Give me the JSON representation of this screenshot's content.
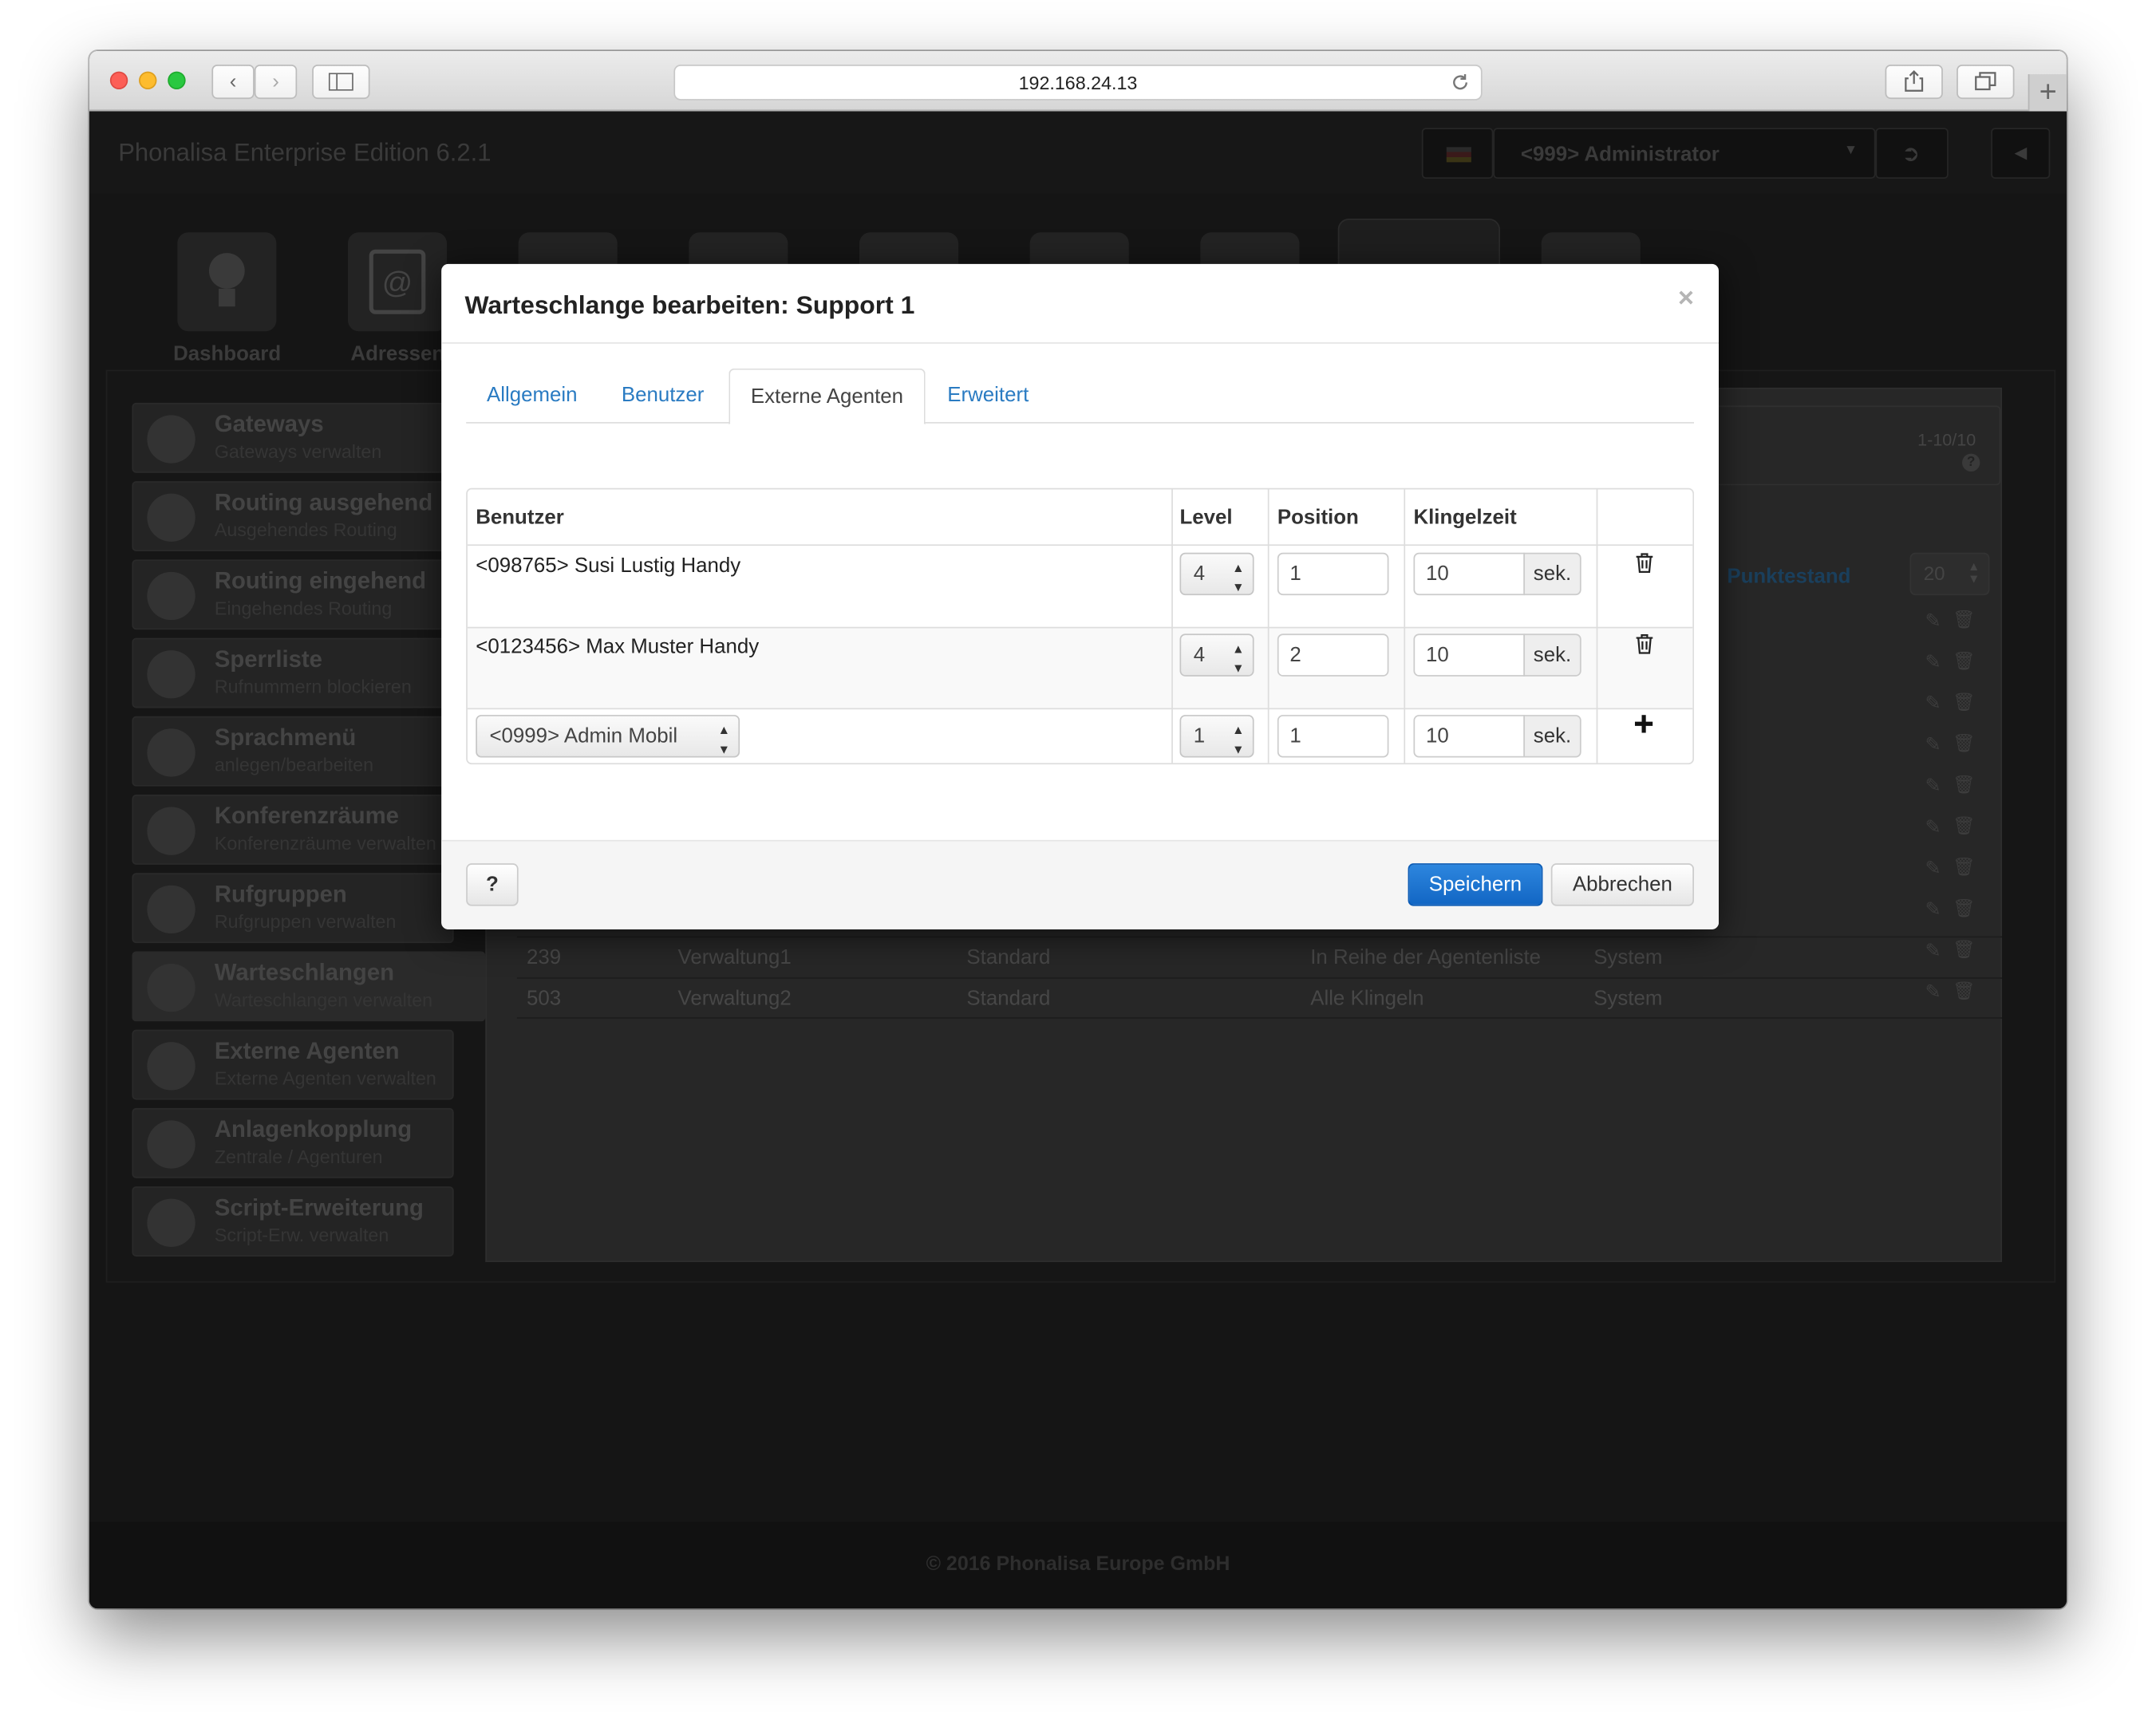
{
  "browser": {
    "url": "192.168.24.13"
  },
  "app": {
    "title": "Phonalisa Enterprise Edition 6.2.1",
    "user": "<999> Administrator",
    "footer": "© 2016 Phonalisa Europe GmbH"
  },
  "iconbar": [
    {
      "label": "Dashboard"
    },
    {
      "label": "Adressen"
    }
  ],
  "sidebar": {
    "items": [
      {
        "title": "Gateways",
        "subtitle": "Gateways verwalten"
      },
      {
        "title": "Routing ausgehend",
        "subtitle": "Ausgehendes Routing"
      },
      {
        "title": "Routing eingehend",
        "subtitle": "Eingehendes Routing"
      },
      {
        "title": "Sperrliste",
        "subtitle": "Rufnummern blockieren"
      },
      {
        "title": "Sprachmenü",
        "subtitle": "anlegen/bearbeiten"
      },
      {
        "title": "Konferenzräume",
        "subtitle": "Konferenzräume verwalten"
      },
      {
        "title": "Rufgruppen",
        "subtitle": "Rufgruppen verwalten"
      },
      {
        "title": "Warteschlangen",
        "subtitle": "Warteschlangen verwalten"
      },
      {
        "title": "Externe Agenten",
        "subtitle": "Externe Agenten verwalten"
      },
      {
        "title": "Anlagenkopplung",
        "subtitle": "Zentrale / Agenturen"
      },
      {
        "title": "Script-Erweiterung",
        "subtitle": "Script-Erw. verwalten"
      }
    ]
  },
  "background_table": {
    "pager": "1-10/10",
    "sort_column": "Punktestand",
    "page_size": "20",
    "rows": [
      {
        "nr": "239",
        "name": "Verwaltung1",
        "typ": "Standard",
        "strategie": "In Reihe der Agentenliste",
        "besitzer": "System"
      },
      {
        "nr": "503",
        "name": "Verwaltung2",
        "typ": "Standard",
        "strategie": "Alle Klingeln",
        "besitzer": "System"
      }
    ]
  },
  "modal": {
    "title": "Warteschlange bearbeiten: Support 1",
    "close": "×",
    "tabs": [
      {
        "label": "Allgemein"
      },
      {
        "label": "Benutzer"
      },
      {
        "label": "Externe Agenten"
      },
      {
        "label": "Erweitert"
      }
    ],
    "active_tab": "Externe Agenten",
    "table": {
      "headers": [
        "Benutzer",
        "Level",
        "Position",
        "Klingelzeit"
      ],
      "rows": [
        {
          "benutzer": "<098765> Susi Lustig Handy",
          "level": "4",
          "position": "1",
          "klingelzeit": "10",
          "unit": "sek.",
          "action": "trash-icon"
        },
        {
          "benutzer": "<0123456> Max Muster Handy",
          "level": "4",
          "position": "2",
          "klingelzeit": "10",
          "unit": "sek.",
          "action": "trash-icon"
        }
      ],
      "new_row": {
        "benutzer": "<0999> Admin Mobil",
        "level": "1",
        "position": "1",
        "klingelzeit": "10",
        "unit": "sek.",
        "action": "plus-icon"
      }
    },
    "help_label": "?",
    "save_label": "Speichern",
    "cancel_label": "Abbrechen"
  },
  "colors": {
    "accent": "#2a7bc2",
    "primary_button": "#1a6fd0",
    "overlay": "#151515"
  }
}
